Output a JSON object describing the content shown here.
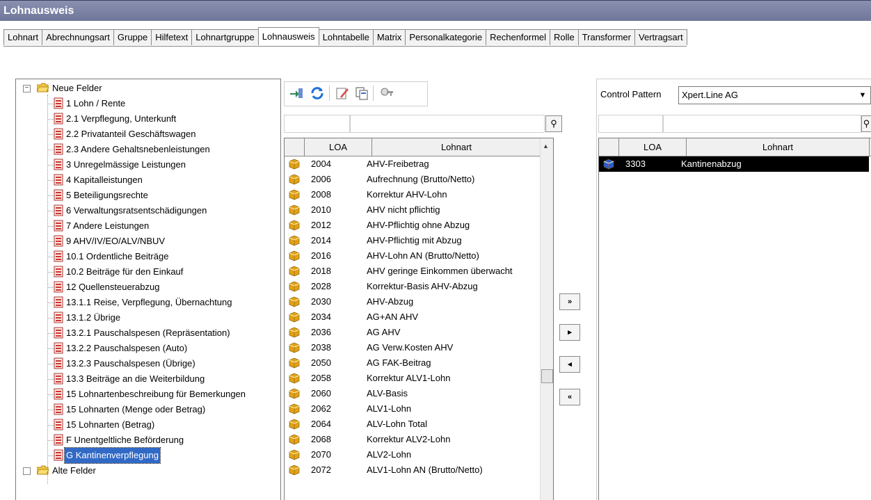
{
  "window": {
    "title": "Lohnausweis"
  },
  "tabs": [
    {
      "label": "Lohnart",
      "active": false
    },
    {
      "label": "Abrechnungsart",
      "active": false
    },
    {
      "label": "Gruppe",
      "active": false
    },
    {
      "label": "Hilfetext",
      "active": false
    },
    {
      "label": "Lohnartgruppe",
      "active": false
    },
    {
      "label": "Lohnausweis",
      "active": true
    },
    {
      "label": "Lohntabelle",
      "active": false
    },
    {
      "label": "Matrix",
      "active": false
    },
    {
      "label": "Personalkategorie",
      "active": false
    },
    {
      "label": "Rechenformel",
      "active": false
    },
    {
      "label": "Rolle",
      "active": false
    },
    {
      "label": "Transformer",
      "active": false
    },
    {
      "label": "Vertragsart",
      "active": false
    }
  ],
  "tree": {
    "root": "Neue Felder",
    "root_toggle": "−",
    "items": [
      "1 Lohn / Rente",
      "2.1 Verpflegung, Unterkunft",
      "2.2 Privatanteil Geschäftswagen",
      "2.3 Andere Gehaltsnebenleistungen",
      "3 Unregelmässige Leistungen",
      "4 Kapitalleistungen",
      "5 Beteiligungsrechte",
      "6 Verwaltungsratsentschädigungen",
      "7 Andere Leistungen",
      "9 AHV/IV/EO/ALV/NBUV",
      "10.1 Ordentliche Beiträge",
      "10.2 Beiträge für den Einkauf",
      "12 Quellensteuerabzug",
      "13.1.1 Reise, Verpflegung, Übernachtung",
      "13.1.2 Übrige",
      "13.2.1 Pauschalspesen (Repräsentation)",
      "13.2.2 Pauschalspesen (Auto)",
      "13.2.3 Pauschalspesen (Übrige)",
      "13.3 Beiträge an die Weiterbildung",
      "15 Lohnartenbeschreibung für Bemerkungen",
      "15 Lohnarten (Menge oder Betrag)",
      "15 Lohnarten (Betrag)",
      "F Unentgeltliche Beförderung",
      "G Kantinenverpflegung"
    ],
    "selected": "G Kantinenverpflegung",
    "next_root": "Alte Felder"
  },
  "toolbar": {
    "icons": [
      "import-icon",
      "refresh-icon",
      "edit-icon",
      "copy-icon",
      "key-settings-icon"
    ]
  },
  "left_grid": {
    "columns": [
      "LOA",
      "Lohnart"
    ],
    "rows": [
      [
        "2004",
        "AHV-Freibetrag"
      ],
      [
        "2006",
        "Aufrechnung (Brutto/Netto)"
      ],
      [
        "2008",
        "Korrektur AHV-Lohn"
      ],
      [
        "2010",
        "AHV nicht pflichtig"
      ],
      [
        "2012",
        "AHV-Pflichtig ohne Abzug"
      ],
      [
        "2014",
        "AHV-Pflichtig mit Abzug"
      ],
      [
        "2016",
        "AHV-Lohn AN (Brutto/Netto)"
      ],
      [
        "2018",
        "AHV geringe Einkommen überwacht"
      ],
      [
        "2028",
        "Korrektur-Basis AHV-Abzug"
      ],
      [
        "2030",
        "AHV-Abzug"
      ],
      [
        "2034",
        "AG+AN AHV"
      ],
      [
        "2036",
        "AG AHV"
      ],
      [
        "2038",
        "AG Verw.Kosten AHV"
      ],
      [
        "2050",
        "AG FAK-Beitrag"
      ],
      [
        "2058",
        "Korrektur ALV1-Lohn"
      ],
      [
        "2060",
        "ALV-Basis"
      ],
      [
        "2062",
        "ALV1-Lohn"
      ],
      [
        "2064",
        "ALV-Lohn Total"
      ],
      [
        "2068",
        "Korrektur ALV2-Lohn"
      ],
      [
        "2070",
        "ALV2-Lohn"
      ],
      [
        "2072",
        "ALV1-Lohn AN (Brutto/Netto)"
      ]
    ]
  },
  "transfer_buttons": [
    {
      "name": "move-all-right-button",
      "glyph": "»"
    },
    {
      "name": "move-right-button",
      "glyph": "▸"
    },
    {
      "name": "move-left-button",
      "glyph": "◂"
    },
    {
      "name": "move-all-left-button",
      "glyph": "«"
    }
  ],
  "control_pattern": {
    "label": "Control Pattern",
    "value": "Xpert.Line AG"
  },
  "right_grid": {
    "columns": [
      "LOA",
      "Lohnart"
    ],
    "rows": [
      [
        "3303",
        "Kantinenabzug"
      ]
    ]
  },
  "key_button_glyph": "⚲",
  "colors": {
    "title_bg": "#6f7699",
    "selection": "#3169c6",
    "cube_gold": "#e0a21a",
    "cube_blue": "#2a5bd7"
  }
}
